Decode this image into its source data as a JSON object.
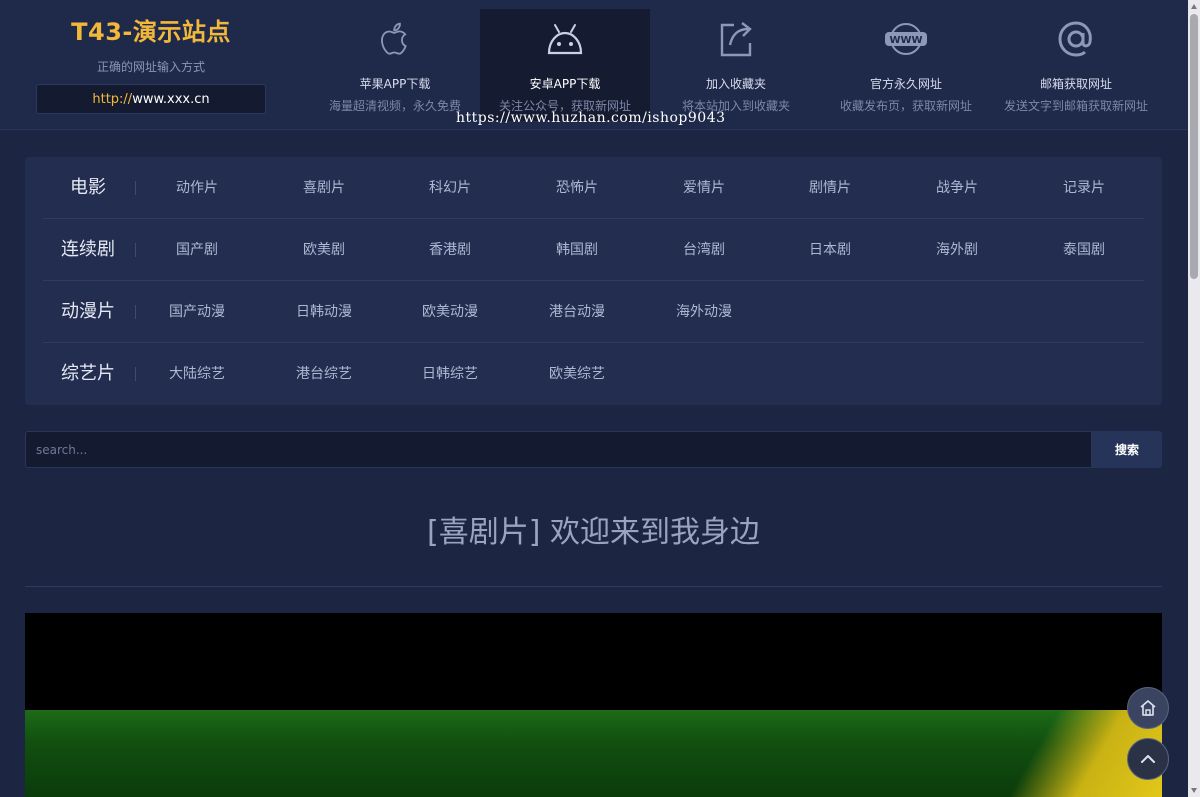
{
  "logo": {
    "title": "T43-演示站点",
    "subtitle": "正确的网址输入方式",
    "url_proto": "http://",
    "url_host": "www.xxx.cn"
  },
  "nav": [
    {
      "label": "苹果APP下载",
      "desc": "海量超清视频，永久免费",
      "icon": "apple-icon"
    },
    {
      "label": "安卓APP下载",
      "desc": "关注公众号，获取新网址",
      "icon": "android-icon"
    },
    {
      "label": "加入收藏夹",
      "desc": "将本站加入到收藏夹",
      "icon": "share-icon"
    },
    {
      "label": "官方永久网址",
      "desc": "收藏发布页，获取新网址",
      "icon": "www-icon"
    },
    {
      "label": "邮箱获取网址",
      "desc": "发送文字到邮箱获取新网址",
      "icon": "at-icon"
    }
  ],
  "watermark": "https://www.huzhan.com/ishop9043",
  "categories": [
    {
      "title": "电影",
      "links": [
        "动作片",
        "喜剧片",
        "科幻片",
        "恐怖片",
        "爱情片",
        "剧情片",
        "战争片",
        "记录片"
      ]
    },
    {
      "title": "连续剧",
      "links": [
        "国产剧",
        "欧美剧",
        "香港剧",
        "韩国剧",
        "台湾剧",
        "日本剧",
        "海外剧",
        "泰国剧"
      ]
    },
    {
      "title": "动漫片",
      "links": [
        "国产动漫",
        "日韩动漫",
        "欧美动漫",
        "港台动漫",
        "海外动漫"
      ]
    },
    {
      "title": "综艺片",
      "links": [
        "大陆综艺",
        "港台综艺",
        "日韩综艺",
        "欧美综艺"
      ]
    }
  ],
  "search": {
    "placeholder": "search...",
    "button": "搜索"
  },
  "page_title": "[喜剧片] 欢迎来到我身边",
  "colors": {
    "accent": "#f3b83a",
    "background": "#1c2541",
    "panel": "#222d50"
  }
}
